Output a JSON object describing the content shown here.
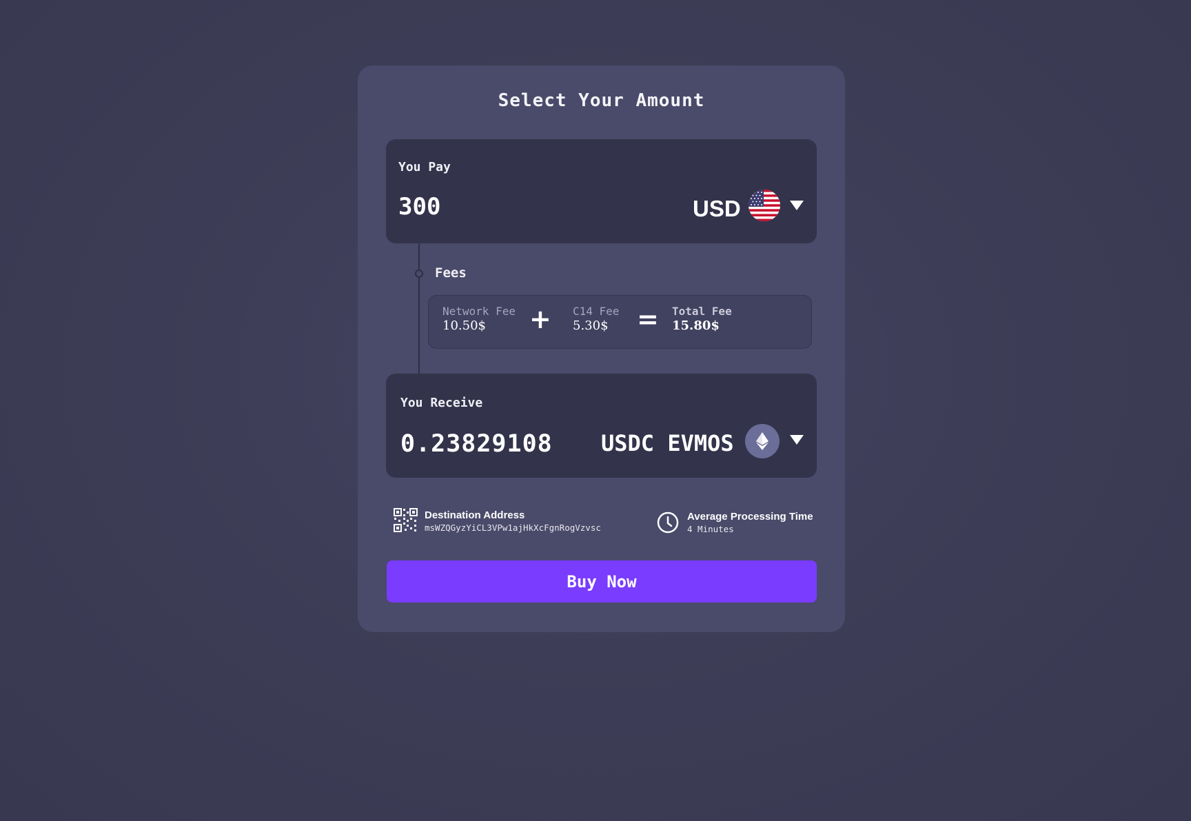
{
  "title": "Select Your Amount",
  "pay": {
    "label": "You Pay",
    "amount": "300",
    "currency": "USD",
    "currency_icon": "us-flag-icon"
  },
  "fees": {
    "label": "Fees",
    "network_fee": {
      "name": "Network Fee",
      "value": "10.50$"
    },
    "plus_symbol": "+",
    "c14_fee": {
      "name": "C14 Fee",
      "value": "5.30$"
    },
    "equals_symbol": "=",
    "total_fee": {
      "name": "Total Fee",
      "value": "15.80$"
    }
  },
  "receive": {
    "label": "You Receive",
    "amount": "0.23829108",
    "currency": "USDC EVMOS",
    "currency_icon": "ethereum-icon"
  },
  "destination": {
    "title": "Destination Address",
    "address": "msWZQGyzYiCL3VPw1ajHkXcFgnRogVzvsc",
    "icon": "qr-code-icon"
  },
  "processing": {
    "title": "Average Processing Time",
    "value": "4 Minutes",
    "icon": "clock-icon"
  },
  "buy_button_label": "Buy Now",
  "colors": {
    "background": "#3d3d57",
    "card": "#4a4a6a",
    "panel": "#33334b",
    "accent": "#7a3cff",
    "eth_badge": "#6b6e98"
  }
}
